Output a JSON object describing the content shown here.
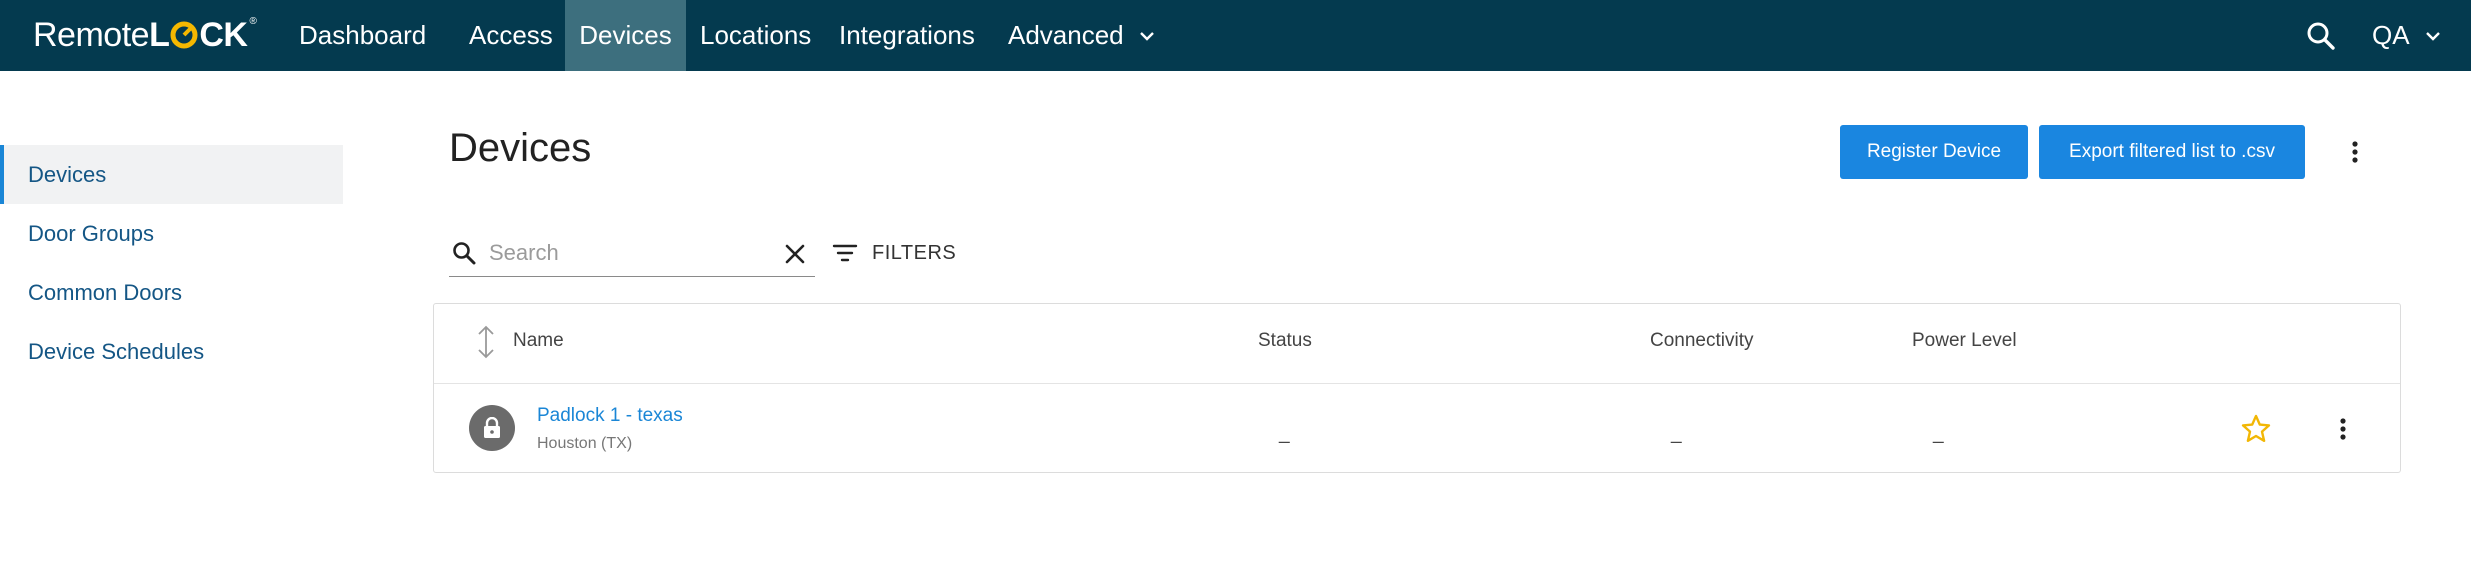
{
  "app": {
    "logo_text_1": "Remote",
    "logo_text_2": "L",
    "logo_text_3": "CK",
    "brand_color": "#043a4f",
    "accent_color": "#1a86e0",
    "logo_accent": "#f5b800"
  },
  "nav": {
    "items": [
      {
        "label": "Dashboard"
      },
      {
        "label": "Access"
      },
      {
        "label": "Devices",
        "active": true
      },
      {
        "label": "Locations"
      },
      {
        "label": "Integrations"
      },
      {
        "label": "Advanced",
        "has_dropdown": true
      }
    ],
    "search_icon": "search-icon",
    "user_label": "QA"
  },
  "sidebar": {
    "items": [
      {
        "label": "Devices",
        "active": true
      },
      {
        "label": "Door Groups"
      },
      {
        "label": "Common Doors"
      },
      {
        "label": "Device Schedules"
      }
    ]
  },
  "main": {
    "title": "Devices",
    "register_button": "Register Device",
    "export_button": "Export filtered list to .csv",
    "search": {
      "placeholder": "Search",
      "value": ""
    },
    "filters_label": "FILTERS"
  },
  "table": {
    "columns": [
      "Name",
      "Status",
      "Connectivity",
      "Power Level"
    ],
    "rows": [
      {
        "name": "Padlock 1 - texas",
        "location": "Houston (TX)",
        "status": "_",
        "connectivity": "_",
        "power_level": "_",
        "icon": "lock-icon",
        "favorite_icon": "star-outline-icon"
      }
    ]
  }
}
